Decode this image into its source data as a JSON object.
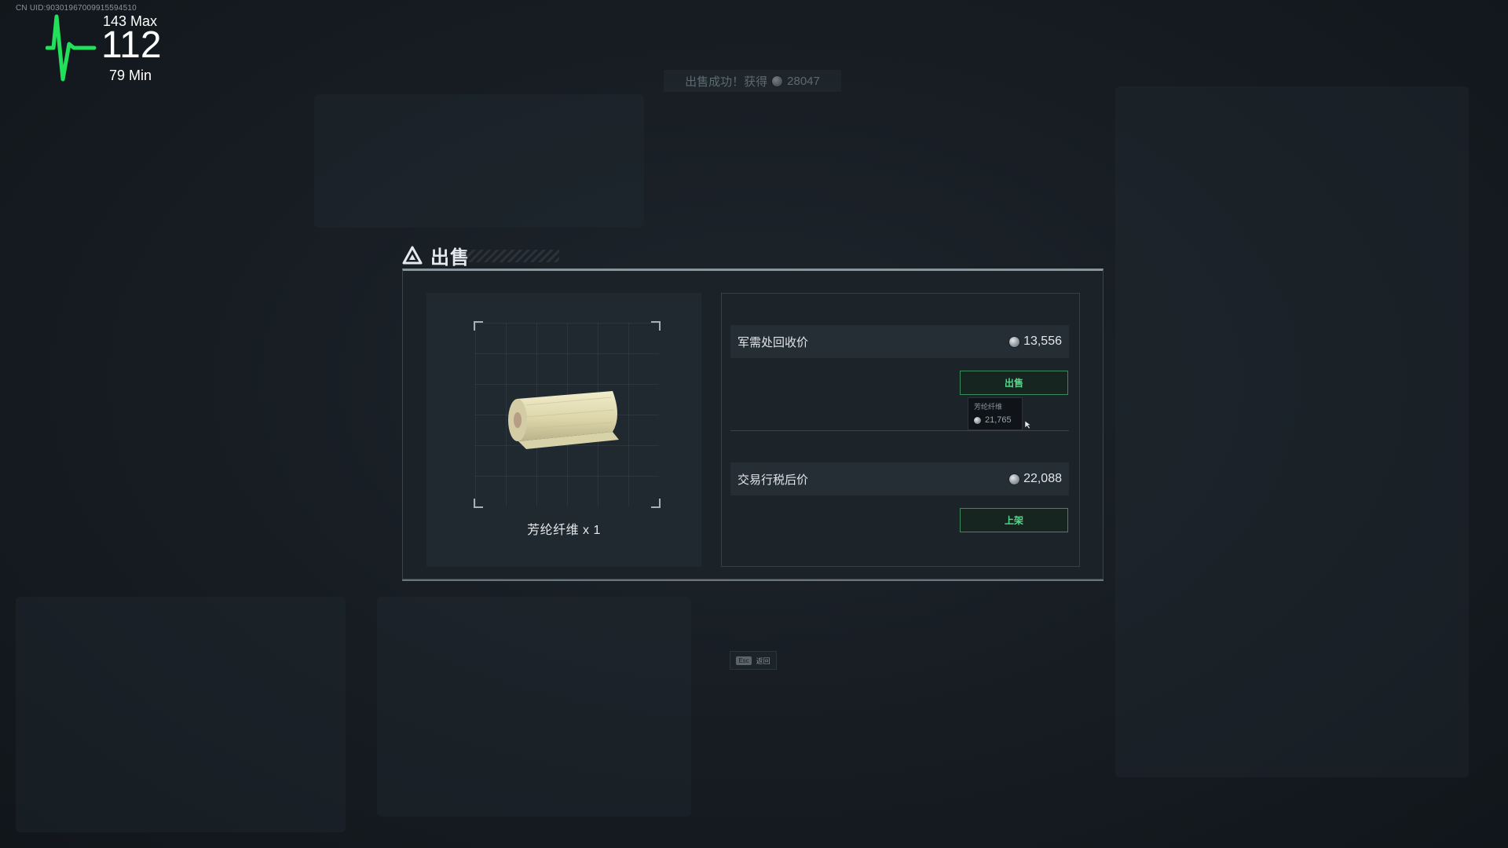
{
  "hud": {
    "uid": "CN UID:9030196700991559451​0",
    "heart_rate": "112",
    "heart_max": "143 Max",
    "heart_min": "79 Min"
  },
  "toast": {
    "text": "出售成功！获得",
    "amount": "28047"
  },
  "dialog": {
    "title": "出售",
    "item": {
      "name": "芳纶纤维 x 1",
      "icon": "fabric-roll-icon"
    },
    "recycle": {
      "label": "军需处回收价",
      "value": "13,556",
      "button": "出售"
    },
    "market": {
      "label": "交易行税后价",
      "value": "22,088",
      "button": "上架"
    },
    "tooltip": {
      "name": "芳纶纤维",
      "price": "21,765"
    }
  },
  "footer": {
    "key": "Esc",
    "label": "返回"
  },
  "colors": {
    "accent_green": "#58d88c",
    "heart_green": "#22e05a"
  }
}
